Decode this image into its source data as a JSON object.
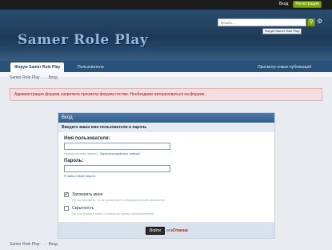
{
  "topbar": {
    "login": "Вход",
    "register": "Регистрация"
  },
  "header": {
    "logo": "Samer Role Play",
    "search_placeholder": "Искать...",
    "search_tooltip": "Форум Samer Role Play",
    "search_icon": "search-icon",
    "settings_icon": "gear-icon"
  },
  "nav": {
    "tabs": [
      {
        "label": "Форум Samer Role Play"
      },
      {
        "label": "Пользователи"
      }
    ],
    "new_content": "Просмотр новых публикаций"
  },
  "breadcrumb": {
    "root": "Samer Role Play",
    "sep": "→",
    "current": "Вход"
  },
  "alert": "Администрация форума запретила просмотр форума гостям. Необходимо авторизоваться на форуме.",
  "login_panel": {
    "title": "Вход",
    "subtitle": "Введите ваши имя пользователя и пароль",
    "username_label": "Имя пользователя:",
    "username_hint": "Нужна учетная запись?",
    "register_link": "Зарегистрируйтесь сейчас!",
    "password_label": "Пароль:",
    "forgot_link": "Я забыл свой пароль",
    "remember": {
      "title": "Запомнить меня",
      "desc": "Не используйте, если используете общедоступный компьютер",
      "checked": true
    },
    "anonymous": {
      "title": "Скрытность",
      "desc": "Не отображать меня в списке активных пользователей",
      "checked": false
    },
    "submit": "Войти",
    "or": "или",
    "cancel": "Отмена"
  }
}
